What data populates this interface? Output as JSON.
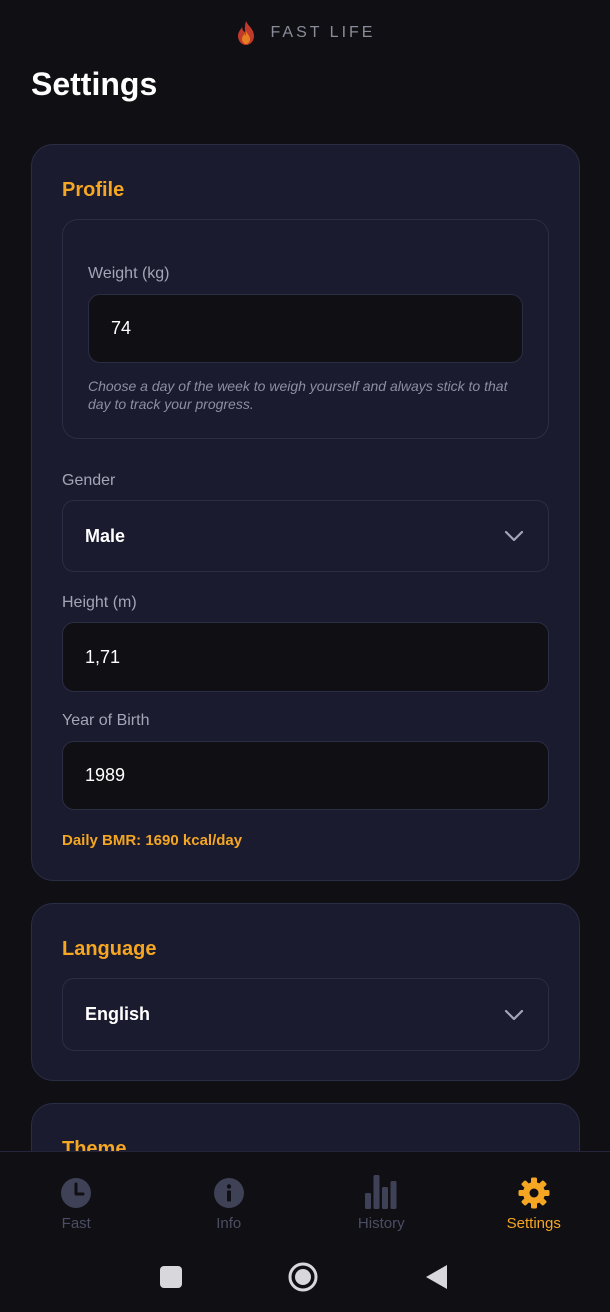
{
  "app": {
    "name": "FAST LIFE",
    "icon": "flame-icon"
  },
  "page": {
    "title": "Settings"
  },
  "colors": {
    "accent": "#f5a623",
    "background": "#0f0f14",
    "card": "#1a1b2e",
    "border": "#2b2d44",
    "inactive": "#4b4e63"
  },
  "profile": {
    "title": "Profile",
    "weight_label": "Weight (kg)",
    "weight_value": "74",
    "weight_hint": "Choose a day of the week to weigh yourself and always stick to that day to track your progress.",
    "gender_label": "Gender",
    "gender_value": "Male",
    "height_label": "Height (m)",
    "height_value": "1,71",
    "birth_label": "Year of Birth",
    "birth_value": "1989",
    "bmr_text": "Daily BMR: 1690 kcal/day"
  },
  "language": {
    "title": "Language",
    "value": "English"
  },
  "theme": {
    "title": "Theme"
  },
  "nav": {
    "items": [
      {
        "label": "Fast",
        "icon": "clock-icon",
        "active": false
      },
      {
        "label": "Info",
        "icon": "info-icon",
        "active": false
      },
      {
        "label": "History",
        "icon": "bar-chart-icon",
        "active": false
      },
      {
        "label": "Settings",
        "icon": "gear-icon",
        "active": true
      }
    ]
  },
  "system_nav": {
    "buttons": [
      "recents-button",
      "home-button",
      "back-button"
    ]
  }
}
